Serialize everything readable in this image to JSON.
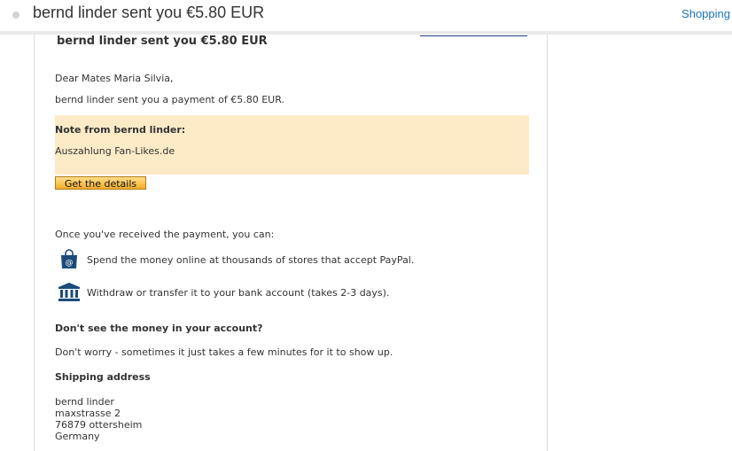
{
  "header": {
    "subject": "bernd linder sent you €5.80 EUR",
    "folder": "Shopping"
  },
  "email": {
    "heading": "bernd linder sent you €5.80 EUR",
    "greeting": "Dear Mates Maria Silvia,",
    "intro": "bernd linder sent you a payment of €5.80 EUR.",
    "note_title": "Note from bernd linder:",
    "note_text": "Auszahlung Fan-Likes.de",
    "details_button": "Get the details",
    "received_text": "Once you've received the payment, you can:",
    "options": [
      {
        "icon": "shopping-bag-icon",
        "text": "Spend the money online at thousands of stores that accept PayPal."
      },
      {
        "icon": "bank-icon",
        "text": "Withdraw or transfer it to your bank account (takes 2-3 days)."
      }
    ],
    "missing_title": "Don't see the money in your account?",
    "missing_text": "Don't worry - sometimes it just takes a few minutes for it to show up.",
    "shipping_title": "Shipping address",
    "shipping_lines": [
      "bernd linder",
      "maxstrasse 2",
      "76879 ottersheim",
      "Germany"
    ]
  },
  "colors": {
    "note_background": "#fdebc8",
    "button_gradient_top": "#ffdf8a",
    "button_gradient_bottom": "#f4ac2b",
    "icon_blue": "#1c4b7a",
    "link_blue": "#1a73b8"
  }
}
